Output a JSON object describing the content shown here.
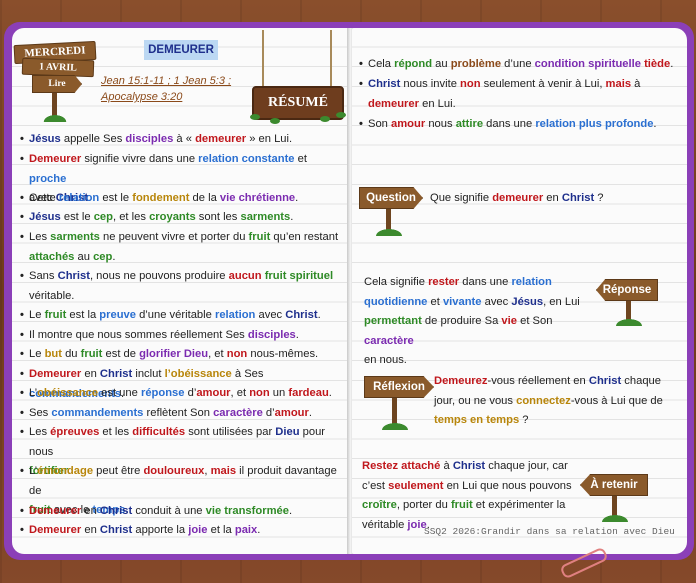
{
  "date_sign": {
    "day": "MERCREDI",
    "date": "1 AVRIL",
    "action": "Lire"
  },
  "title": "DEMEURER",
  "refs": {
    "line1": "Jean 15:1-11 ; 1 Jean 5:3 ;",
    "line2": "Apocalypse 3:20"
  },
  "resume_sign": "RÉSUMÉ",
  "left_bullets": [
    "Jésus appelle Ses disciples à « demeurer » en Lui.",
    "Demeurer signifie vivre dans une relation constante et proche avec Christ.",
    "Cette relation est le fondement de la vie chrétienne.",
    "Jésus est le cep, et les croyants sont les sarments.",
    "Les sarments ne peuvent vivre et porter du fruit qu’en restant attachés au cep.",
    "Sans Christ, nous ne pouvons produire aucun fruit spirituel véritable.",
    "Le fruit est la preuve d’une véritable relation avec Christ.",
    "Il montre que nous sommes réellement Ses disciples.",
    "Le but du fruit est de glorifier Dieu, et non nous-mêmes.",
    "Demeurer en Christ inclut l’obéissance à Ses commandements.",
    "L’obéissance est une réponse d’amour, et non un fardeau.",
    "Ses commandements reflètent Son caractère d’amour.",
    "Les épreuves et les difficultés sont utilisées par Dieu pour nous fortifier.",
    "L’émondage peut être douloureux, mais il produit davantage de fruit avec le temps.",
    "Demeurer en Christ conduit à une vie transformée.",
    "Demeurer en Christ apporte la joie et la paix."
  ],
  "right_bullets": [
    "Cela répond au problème d’une condition spirituelle tiède.",
    "Christ nous invite non seulement à venir à Lui, mais à demeurer en Lui.",
    "Son amour nous attire dans une relation plus profonde."
  ],
  "question": {
    "label": "Question",
    "text": "Que signifie demeurer en Christ ?"
  },
  "reponse": {
    "label": "Réponse",
    "text": "Cela signifie rester dans une relation quotidienne et vivante avec Jésus, en Lui permettant de produire Sa vie et Son caractère en nous."
  },
  "reflexion": {
    "label": "Réflexion",
    "text": "Demeurez-vous réellement en Christ chaque jour, ou ne vous connectez-vous à Lui que de temps en temps ?"
  },
  "retenir": {
    "label": "À retenir",
    "text": "Restez attaché à Christ chaque jour, car c’est seulement en Lui que nous pouvons croître, porter du fruit et expérimenter la véritable joie."
  },
  "footer": "SSQ2 2026:Grandir dans sa relation avec Dieu",
  "colors": {
    "notebook": "#8b3fb8",
    "wood": "#7a4526",
    "red": "#c0171c",
    "blue": "#2a6fd1",
    "green": "#2e8a26",
    "purple": "#7b2bb0",
    "gold": "#b8860b"
  }
}
